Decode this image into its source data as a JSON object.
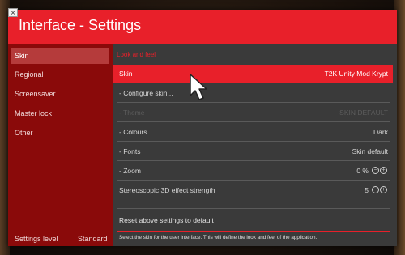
{
  "window": {
    "title": "Interface - Settings",
    "close_glyph": "×"
  },
  "sidebar": {
    "items": [
      {
        "label": "Skin",
        "selected": true
      },
      {
        "label": "Regional",
        "selected": false
      },
      {
        "label": "Screensaver",
        "selected": false
      },
      {
        "label": "Master lock",
        "selected": false
      },
      {
        "label": "Other",
        "selected": false
      }
    ],
    "settings_level_label": "Settings level",
    "settings_level_value": "Standard"
  },
  "content": {
    "section_title": "Look and feel",
    "rows": [
      {
        "label": "Skin",
        "value": "T2K Unity Mod Krypt",
        "state": "selected"
      },
      {
        "label": "- Configure skin...",
        "value": "",
        "state": "normal"
      },
      {
        "label": "- Theme",
        "value": "SKIN DEFAULT",
        "state": "disabled"
      },
      {
        "label": "- Colours",
        "value": "Dark",
        "state": "normal"
      },
      {
        "label": "- Fonts",
        "value": "Skin default",
        "state": "normal"
      },
      {
        "label": "- Zoom",
        "value": "0 %",
        "state": "normal",
        "spinner": true
      },
      {
        "label": "Stereoscopic 3D effect strength",
        "value": "5",
        "state": "normal",
        "spinner": true
      }
    ],
    "reset_label": "Reset above settings to default",
    "help_text": "Select the skin for the user interface. This will define the look and feel of the application."
  },
  "colors": {
    "accent": "#e8202a",
    "sidebar": "#8a0a0a",
    "panel": "#3a3a3a"
  },
  "icons": {
    "spinner_down": "minus-circle-icon",
    "spinner_up": "plus-circle-icon",
    "cursor": "mouse-pointer-icon"
  }
}
